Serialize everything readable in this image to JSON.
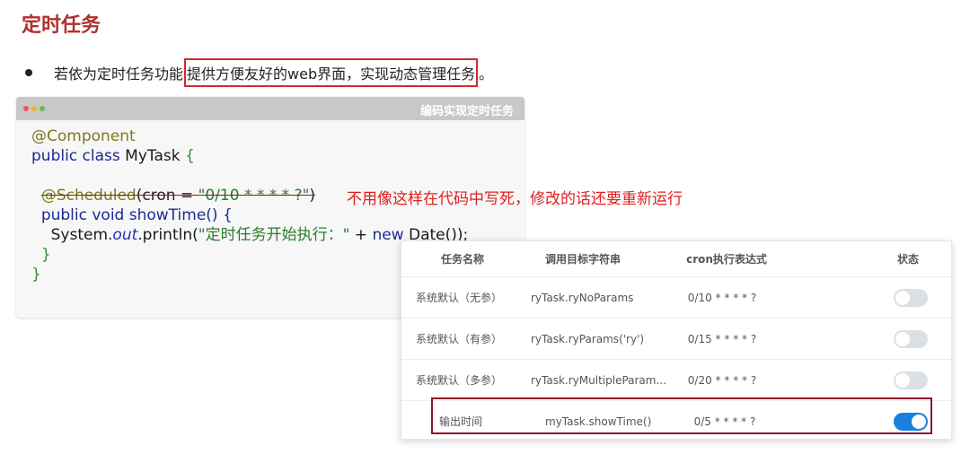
{
  "title": "定时任务",
  "bullet": {
    "prefix": "若依为定时任务功能",
    "highlight": "提供方便友好的web界面，实现动态管理任务",
    "suffix": "。"
  },
  "code_window": {
    "title": "编码实现定时任务",
    "lines": {
      "l1_ann": "@Component",
      "l2_kw": "public class ",
      "l2_name": "MyTask ",
      "l2_brace": "{",
      "l4_ann": "@Scheduled",
      "l4_open": "(cron = ",
      "l4_str": "\"0/10 * * * * ?\"",
      "l4_close": ")",
      "l5_kw": "public void ",
      "l5_name": "showTime() {",
      "l6_a": "System.",
      "l6_out": "out",
      "l6_b": ".println(",
      "l6_str": "\"定时任务开始执行：\"",
      "l6_c": " + ",
      "l6_new": "new",
      "l6_d": " Date());",
      "l7": "}",
      "l8": "}"
    }
  },
  "annotation_comment": "不用像这样在代码中写死，修改的话还要重新运行",
  "table": {
    "headers": [
      "任务名称",
      "调用目标字符串",
      "cron执行表达式",
      "状态"
    ],
    "rows": [
      {
        "name": "系统默认（无参）",
        "target": "ryTask.ryNoParams",
        "cron": "0/10 * * * * ?",
        "status_on": false
      },
      {
        "name": "系统默认（有参）",
        "target": "ryTask.ryParams('ry')",
        "cron": "0/15 * * * * ?",
        "status_on": false
      },
      {
        "name": "系统默认（多参）",
        "target": "ryTask.ryMultipleParam...",
        "cron": "0/20 * * * * ?",
        "status_on": false
      },
      {
        "name": "输出时间",
        "target": "myTask.showTime()",
        "cron": "0/5 * * * * ?",
        "status_on": true
      }
    ]
  },
  "colors": {
    "title": "#b03030",
    "highlight_border": "#d42a2a",
    "comment": "#e01e1e",
    "toggle_on": "#1a7fe0",
    "toggle_off": "#dcdfe6"
  }
}
